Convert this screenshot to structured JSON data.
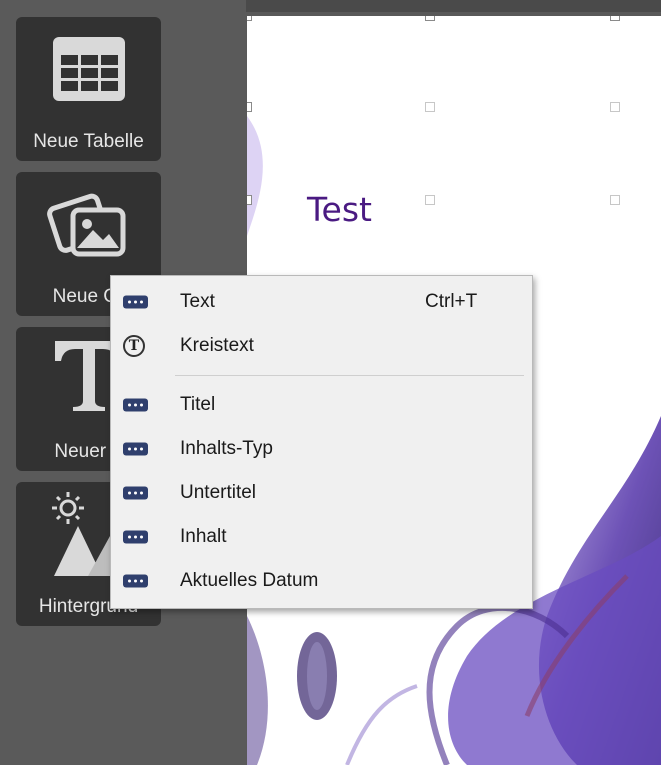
{
  "tools": [
    {
      "label": "Neue Tabelle",
      "icon": "table-icon"
    },
    {
      "label": "Neue Gr",
      "icon": "picture-icon"
    },
    {
      "label": "Neuer T",
      "icon": "text-t-icon"
    },
    {
      "label": "Hintergrund",
      "icon": "background-icon"
    }
  ],
  "canvas": {
    "text": "Test"
  },
  "context_menu": {
    "items": [
      {
        "label": "Text",
        "shortcut": "Ctrl+T",
        "icon": "placeholder-dots-icon"
      },
      {
        "label": "Kreistext",
        "icon": "circle-t-icon"
      },
      {
        "label": "Titel",
        "icon": "placeholder-dots-icon"
      },
      {
        "label": "Inhalts-Typ",
        "icon": "placeholder-dots-icon"
      },
      {
        "label": "Untertitel",
        "icon": "placeholder-dots-icon"
      },
      {
        "label": "Inhalt",
        "icon": "placeholder-dots-icon"
      },
      {
        "label": "Aktuelles Datum",
        "icon": "placeholder-dots-icon"
      }
    ]
  },
  "colors": {
    "sidebar_bg": "#5a5a5a",
    "tool_bg": "#323232",
    "canvas_text": "#4a1a82",
    "menu_icon": "#2f3f6d"
  }
}
